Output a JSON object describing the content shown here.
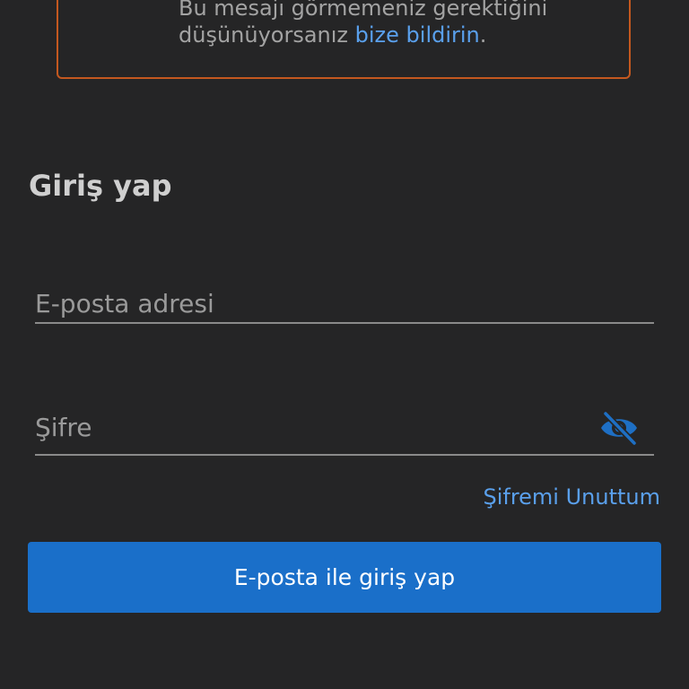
{
  "notice": {
    "text_line1": "Bu mesajı görmemeniz gerektiğini",
    "text_line2": "düşünüyorsanız ",
    "link": "bize bildirin",
    "suffix": "."
  },
  "login": {
    "title": "Giriş yap",
    "email_placeholder": "E-posta adresi",
    "password_placeholder": "Şifre",
    "forgot_label": "Şifremi Unuttum",
    "submit_label": "E-posta ile giriş yap"
  },
  "colors": {
    "background": "#252526",
    "notice_border": "#c4581f",
    "link": "#5aa0ec",
    "primary_button": "#1a6fc9",
    "eye_icon": "#1e6fc4"
  },
  "icons": {
    "password_toggle": "eye-slash-icon"
  }
}
